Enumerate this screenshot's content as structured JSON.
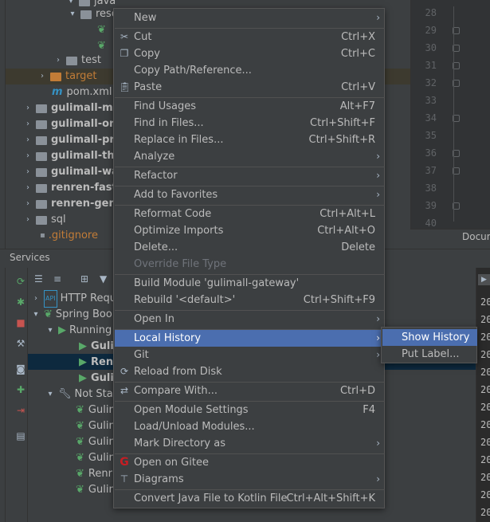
{
  "project_tree": {
    "rows": [
      {
        "label": "java",
        "kind": "folder"
      },
      {
        "label": "reso",
        "kind": "folder"
      },
      {
        "label": "test",
        "kind": "folder"
      },
      {
        "label": "target",
        "kind": "folder-orange"
      },
      {
        "label": "pom.xml",
        "kind": "maven"
      },
      {
        "label": "gulimall-me",
        "kind": "module"
      },
      {
        "label": "gulimall-ord",
        "kind": "module"
      },
      {
        "label": "gulimall-pro",
        "kind": "module"
      },
      {
        "label": "gulimall-thi",
        "kind": "module"
      },
      {
        "label": "gulimall-wa",
        "kind": "module"
      },
      {
        "label": "renren-fast",
        "kind": "module"
      },
      {
        "label": "renren-gene",
        "kind": "module"
      },
      {
        "label": "sql",
        "kind": "folder"
      },
      {
        "label": ".gitignore",
        "kind": "file"
      }
    ]
  },
  "editor": {
    "line_numbers": [
      "28",
      "29",
      "30",
      "31",
      "32",
      "33",
      "34",
      "35",
      "36",
      "37",
      "38",
      "39",
      "40"
    ],
    "doc_tab": "Docum"
  },
  "services": {
    "title": "Services",
    "tree": [
      {
        "label": "HTTP Requ"
      },
      {
        "label": "Spring Boo"
      },
      {
        "label": "Running"
      },
      {
        "label": "Gulin"
      },
      {
        "label": "Renr"
      },
      {
        "label": "Gulin"
      },
      {
        "label": "Not Sta"
      },
      {
        "label": "Gulin"
      },
      {
        "label": "Gulin"
      },
      {
        "label": "Gulin"
      },
      {
        "label": "Gulin"
      },
      {
        "label": "Renr"
      },
      {
        "label": "Gulin"
      }
    ],
    "log_numbers": [
      "20",
      "20",
      "20",
      "20",
      "20",
      "20",
      "20",
      "20",
      "20",
      "20",
      "20",
      "20",
      "20",
      "20",
      "20"
    ]
  },
  "context_menu": {
    "items": [
      {
        "label": "New",
        "shortcut": "",
        "submenu": true,
        "icon": ""
      },
      {
        "label": "Cut",
        "shortcut": "Ctrl+X",
        "icon": "scissors-icon"
      },
      {
        "label": "Copy",
        "shortcut": "Ctrl+C",
        "icon": "copy-icon"
      },
      {
        "label": "Copy Path/Reference...",
        "shortcut": "",
        "icon": ""
      },
      {
        "label": "Paste",
        "shortcut": "Ctrl+V",
        "icon": "paste-icon"
      },
      {
        "label": "Find Usages",
        "shortcut": "Alt+F7",
        "icon": ""
      },
      {
        "label": "Find in Files...",
        "shortcut": "Ctrl+Shift+F",
        "icon": ""
      },
      {
        "label": "Replace in Files...",
        "shortcut": "Ctrl+Shift+R",
        "icon": ""
      },
      {
        "label": "Analyze",
        "shortcut": "",
        "submenu": true,
        "icon": ""
      },
      {
        "label": "Refactor",
        "shortcut": "",
        "submenu": true,
        "icon": ""
      },
      {
        "label": "Add to Favorites",
        "shortcut": "",
        "submenu": true,
        "icon": ""
      },
      {
        "label": "Reformat Code",
        "shortcut": "Ctrl+Alt+L",
        "icon": ""
      },
      {
        "label": "Optimize Imports",
        "shortcut": "Ctrl+Alt+O",
        "icon": ""
      },
      {
        "label": "Delete...",
        "shortcut": "Delete",
        "icon": ""
      },
      {
        "label": "Override File Type",
        "shortcut": "",
        "disabled": true,
        "icon": ""
      },
      {
        "label": "Build Module 'gulimall-gateway'",
        "shortcut": "",
        "icon": ""
      },
      {
        "label": "Rebuild '<default>'",
        "shortcut": "Ctrl+Shift+F9",
        "icon": ""
      },
      {
        "label": "Open In",
        "shortcut": "",
        "submenu": true,
        "icon": ""
      },
      {
        "label": "Local History",
        "shortcut": "",
        "submenu": true,
        "highlighted": true,
        "icon": ""
      },
      {
        "label": "Git",
        "shortcut": "",
        "submenu": true,
        "icon": ""
      },
      {
        "label": "Reload from Disk",
        "shortcut": "",
        "icon": "reload-icon"
      },
      {
        "label": "Compare With...",
        "shortcut": "Ctrl+D",
        "icon": "compare-icon"
      },
      {
        "label": "Open Module Settings",
        "shortcut": "F4",
        "icon": ""
      },
      {
        "label": "Load/Unload Modules...",
        "shortcut": "",
        "icon": ""
      },
      {
        "label": "Mark Directory as",
        "shortcut": "",
        "submenu": true,
        "icon": ""
      },
      {
        "label": "Open on Gitee",
        "shortcut": "",
        "icon": "gitee-icon"
      },
      {
        "label": "Diagrams",
        "shortcut": "",
        "submenu": true,
        "icon": "diagrams-icon"
      },
      {
        "label": "Convert Java File to Kotlin File",
        "shortcut": "Ctrl+Alt+Shift+K",
        "icon": ""
      }
    ]
  },
  "submenu": {
    "items": [
      {
        "label": "Show History",
        "highlighted": true
      },
      {
        "label": "Put Label..."
      }
    ]
  },
  "colors": {
    "highlight": "#4b6eaf",
    "panel": "#3c3f41",
    "editor": "#2b2b2b",
    "gitee": "#c71d23"
  }
}
